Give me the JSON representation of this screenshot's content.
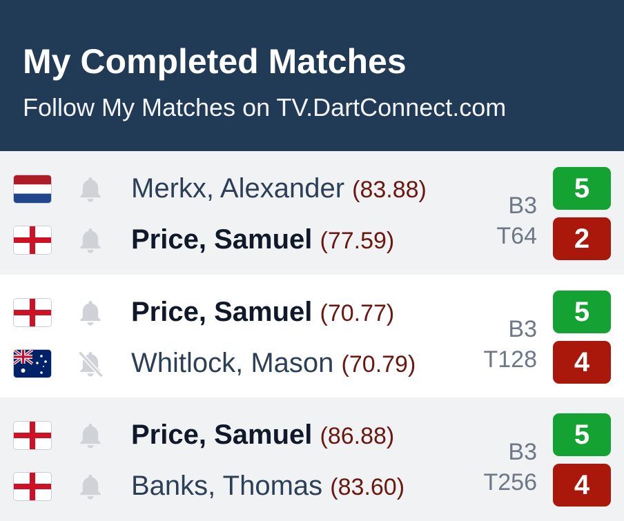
{
  "header": {
    "title": "My Completed Matches",
    "subtitle": "Follow My Matches on TV.DartConnect.com"
  },
  "colors": {
    "header_bg": "#213a56",
    "win": "#14a332",
    "loss": "#a9180b",
    "average": "#6a1710"
  },
  "matches": [
    {
      "round": "B3",
      "stage": "T64",
      "players": [
        {
          "flag": "netherlands-flag",
          "bell": "bell-icon",
          "name": "Merkx, Alexander",
          "average": "(83.88)",
          "score": "5",
          "result": "win",
          "bold": false
        },
        {
          "flag": "england-flag",
          "bell": "bell-icon",
          "name": "Price, Samuel",
          "average": "(77.59)",
          "score": "2",
          "result": "loss",
          "bold": true
        }
      ]
    },
    {
      "round": "B3",
      "stage": "T128",
      "players": [
        {
          "flag": "england-flag",
          "bell": "bell-icon",
          "name": "Price, Samuel",
          "average": "(70.77)",
          "score": "5",
          "result": "win",
          "bold": true
        },
        {
          "flag": "australia-flag",
          "bell": "bell-off-icon",
          "name": "Whitlock, Mason",
          "average": "(70.79)",
          "score": "4",
          "result": "loss",
          "bold": false
        }
      ]
    },
    {
      "round": "B3",
      "stage": "T256",
      "players": [
        {
          "flag": "england-flag",
          "bell": "bell-icon",
          "name": "Price, Samuel",
          "average": "(86.88)",
          "score": "5",
          "result": "win",
          "bold": true
        },
        {
          "flag": "england-flag",
          "bell": "bell-icon",
          "name": "Banks, Thomas",
          "average": "(83.60)",
          "score": "4",
          "result": "loss",
          "bold": false
        }
      ]
    }
  ]
}
